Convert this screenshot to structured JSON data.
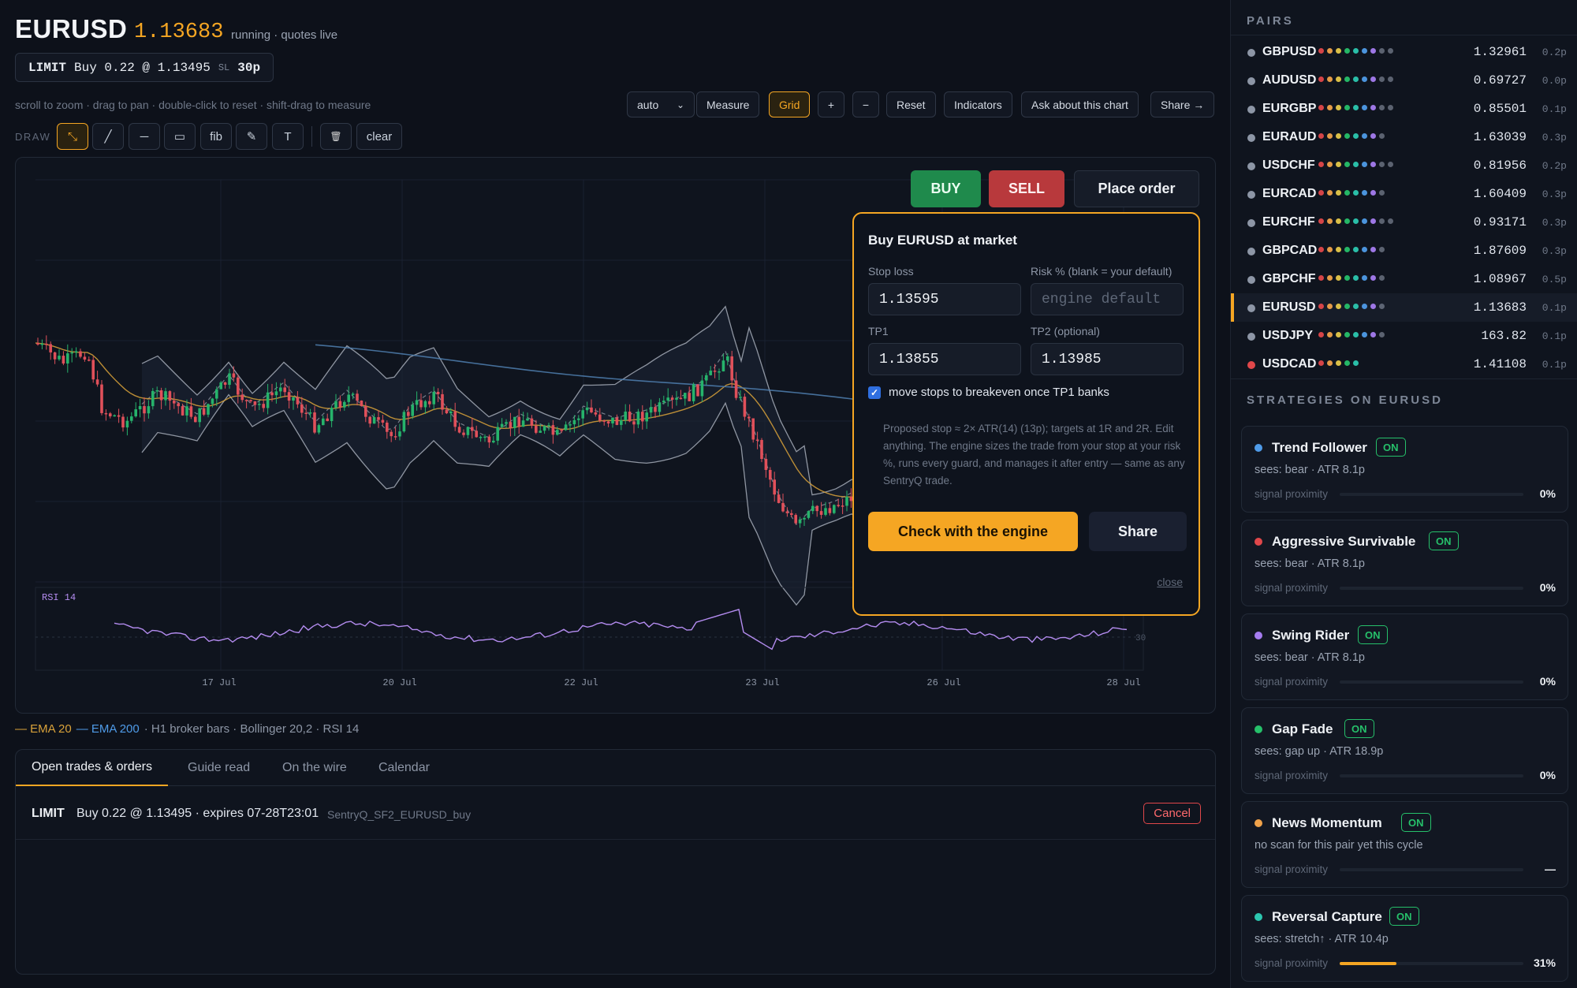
{
  "header": {
    "symbol": "EURUSD",
    "price": "1.13683",
    "status": "running · quotes live",
    "order_summary": {
      "type": "LIMIT",
      "desc": "Buy 0.22 @ 1.13495",
      "sl_label": "SL",
      "sl_value": "30p"
    },
    "hint": "scroll to zoom · drag to pan · double-click to reset · shift-drag to measure"
  },
  "toolbar": {
    "timeframe": "auto",
    "buttons": [
      "Measure",
      "Grid",
      "+",
      "−",
      "Reset",
      "Indicators",
      "Ask about this chart",
      "Share →"
    ],
    "active": "Grid"
  },
  "draw_toolbar": {
    "label": "DRAW",
    "tools": [
      {
        "name": "cursor-icon",
        "glyph": "⤡",
        "active": true
      },
      {
        "name": "trendline-icon",
        "glyph": "╱"
      },
      {
        "name": "hline-icon",
        "glyph": "─"
      },
      {
        "name": "rectangle-icon",
        "glyph": "▭"
      },
      {
        "name": "fib-tool",
        "glyph": "fib"
      },
      {
        "name": "brush-icon",
        "glyph": "✎"
      },
      {
        "name": "text-tool",
        "glyph": "T"
      },
      {
        "name": "trash-icon",
        "glyph": "🗑"
      }
    ],
    "clear_label": "clear"
  },
  "trade_buttons": {
    "buy": "BUY",
    "sell": "SELL",
    "place": "Place order"
  },
  "order_form": {
    "title": "Buy EURUSD at market",
    "stop_loss_label": "Stop loss",
    "stop_loss_value": "1.13595",
    "risk_label": "Risk % (blank = your default)",
    "risk_placeholder": "engine default",
    "tp1_label": "TP1",
    "tp1_value": "1.13855",
    "tp2_label": "TP2 (optional)",
    "tp2_value": "1.13985",
    "breakeven_label": "move stops to breakeven once TP1 banks",
    "breakeven_checked": true,
    "note": "Proposed stop ≈ 2× ATR(14) (13p); targets at 1R and 2R. Edit anything. The engine sizes the trade from your stop at your risk %, runs every guard, and manages it after entry — same as any SentryQ trade.",
    "check_label": "Check with the engine",
    "share_label": "Share",
    "close_label": "close"
  },
  "chart_data": {
    "type": "candlestick",
    "symbol": "EURUSD",
    "x_ticks": [
      "17 Jul",
      "20 Jul",
      "22 Jul",
      "23 Jul",
      "26 Jul",
      "28 Jul"
    ],
    "indicators": [
      "EMA 20",
      "EMA 200",
      "Bollinger 20,2",
      "RSI 14"
    ],
    "rsi_label": "RSI 14",
    "rsi_ref_label": "30",
    "grid": true,
    "colors": {
      "up": "#26b36b",
      "down": "#e0505a",
      "ema20": "#d9a23a",
      "ema200": "#4f7fb0",
      "bollinger": "#b9c0cc",
      "rsi": "#b48cf0"
    }
  },
  "legend": {
    "ema20": "EMA 20",
    "ema200": "EMA 200",
    "rest": "· H1 broker bars · Bollinger 20,2 · RSI 14"
  },
  "bottom": {
    "tabs": [
      "Open trades & orders",
      "Guide read",
      "On the wire",
      "Calendar"
    ],
    "active_tab": "Open trades & orders",
    "order_row": {
      "type": "LIMIT",
      "desc": "Buy 0.22 @ 1.13495 · expires 07-28T23:01",
      "tag": "SentryQ_SF2_EURUSD_buy",
      "cancel": "Cancel"
    }
  },
  "sidebar": {
    "pairs_title": "PAIRS",
    "pairs": [
      {
        "name": "GBPUSD",
        "price": "1.32961",
        "spread": "0.2p",
        "dot": "#8d96a6",
        "mini": 9
      },
      {
        "name": "AUDUSD",
        "price": "0.69727",
        "spread": "0.0p",
        "dot": "#8d96a6",
        "mini": 9
      },
      {
        "name": "EURGBP",
        "price": "0.85501",
        "spread": "0.1p",
        "dot": "#8d96a6",
        "mini": 9
      },
      {
        "name": "EURAUD",
        "price": "1.63039",
        "spread": "0.3p",
        "dot": "#8d96a6",
        "mini": 8
      },
      {
        "name": "USDCHF",
        "price": "0.81956",
        "spread": "0.2p",
        "dot": "#8d96a6",
        "mini": 9
      },
      {
        "name": "EURCAD",
        "price": "1.60409",
        "spread": "0.3p",
        "dot": "#8d96a6",
        "mini": 8
      },
      {
        "name": "EURCHF",
        "price": "0.93171",
        "spread": "0.3p",
        "dot": "#8d96a6",
        "mini": 9
      },
      {
        "name": "GBPCAD",
        "price": "1.87609",
        "spread": "0.3p",
        "dot": "#8d96a6",
        "mini": 8
      },
      {
        "name": "GBPCHF",
        "price": "1.08967",
        "spread": "0.5p",
        "dot": "#8d96a6",
        "mini": 8
      },
      {
        "name": "EURUSD",
        "price": "1.13683",
        "spread": "0.1p",
        "dot": "#8d96a6",
        "mini": 8,
        "active": true
      },
      {
        "name": "USDJPY",
        "price": "163.82",
        "spread": "0.1p",
        "dot": "#8d96a6",
        "mini": 8
      },
      {
        "name": "USDCAD",
        "price": "1.41108",
        "spread": "0.1p",
        "dot": "#e0474a",
        "mini": 5
      }
    ],
    "strategies_title": "STRATEGIES ON EURUSD",
    "strategies": [
      {
        "name": "Trend Follower",
        "status": "ON",
        "sees": "sees: bear · ATR 8.1p",
        "proximity_label": "signal proximity",
        "proximity": "0%",
        "proximity_value": 0,
        "dot": "#4f9be8"
      },
      {
        "name": "Aggressive Survivable",
        "status": "ON",
        "sees": "sees: bear · ATR 8.1p",
        "proximity_label": "signal proximity",
        "proximity": "0%",
        "proximity_value": 0,
        "dot": "#e0474a"
      },
      {
        "name": "Swing Rider",
        "status": "ON",
        "sees": "sees: bear · ATR 8.1p",
        "proximity_label": "signal proximity",
        "proximity": "0%",
        "proximity_value": 0,
        "dot": "#a57cf0"
      },
      {
        "name": "Gap Fade",
        "status": "ON",
        "sees": "sees: gap up · ATR 18.9p",
        "proximity_label": "signal proximity",
        "proximity": "0%",
        "proximity_value": 0,
        "dot": "#26c06a"
      },
      {
        "name": "News Momentum",
        "status": "ON",
        "sees": "no scan for this pair yet this cycle",
        "proximity_label": "signal proximity",
        "proximity": "—",
        "proximity_value": 0,
        "dot": "#f0a24a"
      },
      {
        "name": "Reversal Capture",
        "status": "ON",
        "sees": "sees: stretch↑ · ATR 10.4p",
        "proximity_label": "signal proximity",
        "proximity": "31%",
        "proximity_value": 0.31,
        "dot": "#2cc7b0"
      }
    ]
  }
}
